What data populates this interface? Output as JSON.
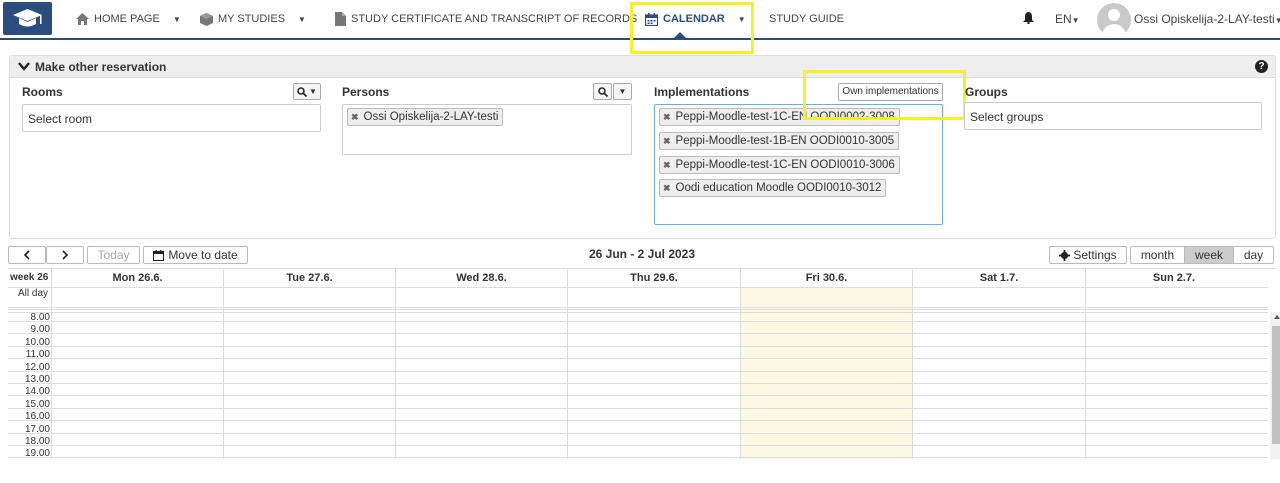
{
  "navbar": {
    "items": [
      {
        "label": "HOME PAGE",
        "icon": "home-icon"
      },
      {
        "label": "MY STUDIES",
        "icon": "cube-icon"
      },
      {
        "label": "STUDY CERTIFICATE AND TRANSCRIPT OF RECORDS",
        "icon": "document-icon"
      },
      {
        "label": "CALENDAR",
        "icon": "calendar-icon"
      },
      {
        "label": "STUDY GUIDE"
      }
    ],
    "language": "EN",
    "user_name": "Ossi Opiskelija-2-LAY-testi"
  },
  "reservation": {
    "title": "Make other reservation",
    "rooms": {
      "label": "Rooms",
      "placeholder": "Select room"
    },
    "persons": {
      "label": "Persons",
      "tags": [
        "Ossi Opiskelija-2-LAY-testi"
      ]
    },
    "implementations": {
      "label": "Implementations",
      "own_button": "Own implementations",
      "tags": [
        "Peppi-Moodle-test-1C-EN OODI0002-3008",
        "Peppi-Moodle-test-1B-EN OODI0010-3005",
        "Peppi-Moodle-test-1C-EN OODI0010-3006",
        "Oodi education Moodle OODI0010-3012"
      ]
    },
    "groups": {
      "label": "Groups",
      "placeholder": "Select groups"
    }
  },
  "calendar": {
    "range_title": "26 Jun - 2 Jul 2023",
    "today_label": "Today",
    "move_to_date_label": "Move to date",
    "settings_label": "Settings",
    "views": [
      "month",
      "week",
      "day"
    ],
    "active_view": "week",
    "week_label": "week 26",
    "allday_label": "All day",
    "days": [
      "Mon 26.6.",
      "Tue 27.6.",
      "Wed 28.6.",
      "Thu 29.6.",
      "Fri 30.6.",
      "Sat 1.7.",
      "Sun 2.7."
    ],
    "highlighted_day": "Fri 30.6.",
    "hours": [
      "8.00",
      "9.00",
      "10.00",
      "11.00",
      "12.00",
      "13.00",
      "14.00",
      "15.00",
      "16.00",
      "17.00",
      "18.00",
      "19.00"
    ]
  },
  "colors": {
    "brand": "#2b4d7e",
    "highlight": "#f5f02a",
    "today": "#fcf8e3"
  }
}
